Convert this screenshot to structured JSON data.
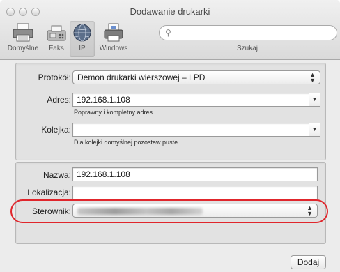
{
  "window": {
    "title": "Dodawanie drukarki"
  },
  "toolbar": {
    "items": [
      {
        "label": "Domyślne",
        "icon": "printer-icon"
      },
      {
        "label": "Faks",
        "icon": "fax-icon"
      },
      {
        "label": "IP",
        "icon": "globe-icon"
      },
      {
        "label": "Windows",
        "icon": "windows-printer-icon"
      }
    ],
    "selected": "IP",
    "search_label": "Szukaj",
    "search_placeholder": ""
  },
  "form": {
    "protocol_label": "Protokół:",
    "protocol_value": "Demon drukarki wierszowej – LPD",
    "address_label": "Adres:",
    "address_value": "192.168.1.108",
    "address_hint": "Poprawny i kompletny adres.",
    "queue_label": "Kolejka:",
    "queue_value": "",
    "queue_hint": "Dla kolejki domyślnej pozostaw puste.",
    "name_label": "Nazwa:",
    "name_value": "192.168.1.108",
    "location_label": "Lokalizacja:",
    "location_value": "",
    "driver_label": "Sterownik:"
  },
  "actions": {
    "add_label": "Dodaj"
  },
  "colors": {
    "highlight": "#e0262c"
  }
}
